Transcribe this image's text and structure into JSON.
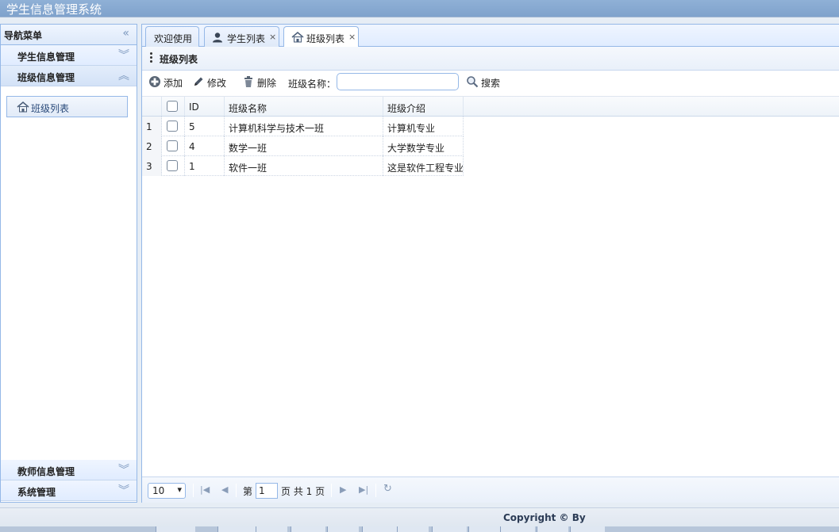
{
  "app": {
    "title": "学生信息管理系统"
  },
  "nav": {
    "title": "导航菜单",
    "sections": [
      {
        "label": "学生信息管理"
      },
      {
        "label": "班级信息管理"
      },
      {
        "label": "教师信息管理"
      },
      {
        "label": "系统管理"
      }
    ],
    "active_item": "班级列表"
  },
  "tabs": [
    {
      "label": "欢迎使用"
    },
    {
      "label": "学生列表"
    },
    {
      "label": "班级列表"
    }
  ],
  "tab_close": "×",
  "panel": {
    "title": "班级列表"
  },
  "toolbar": {
    "add": "添加",
    "edit": "修改",
    "delete": "删除",
    "search_label": "班级名称：",
    "search_value": "",
    "search_button": "搜索"
  },
  "grid": {
    "columns": [
      "ID",
      "班级名称",
      "班级介绍"
    ],
    "rows": [
      {
        "num": "1",
        "id": "5",
        "name": "计算机科学与技术一班",
        "intro": "计算机专业"
      },
      {
        "num": "2",
        "id": "4",
        "name": "数学一班",
        "intro": "大学数学专业"
      },
      {
        "num": "3",
        "id": "1",
        "name": "软件一班",
        "intro": "这是软件工程专业"
      }
    ]
  },
  "pager": {
    "page_size": "10",
    "before": "第",
    "page": "1",
    "after": "页 共 1 页"
  },
  "footer": {
    "copyright": "Copyright © By"
  }
}
